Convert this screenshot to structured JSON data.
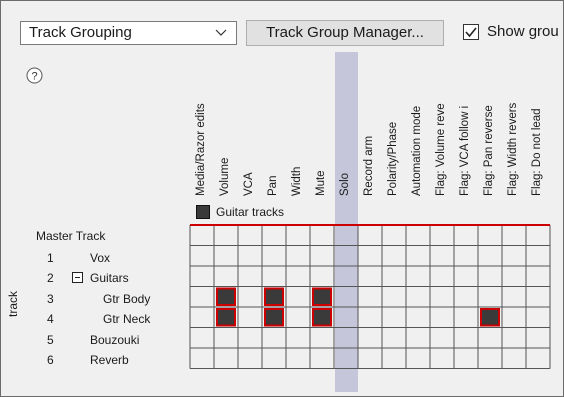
{
  "toolbar": {
    "dropdown_value": "Track Grouping",
    "manager_button": "Track Group Manager...",
    "show_checkbox_label": "Show grou",
    "show_checked": true
  },
  "help_icon": "question-circle-icon",
  "columns": [
    "Media/Razor edits",
    "Volume",
    "VCA",
    "Pan",
    "Width",
    "Mute",
    "Solo",
    "Record arm",
    "Polarity/Phase",
    "Automation mode",
    "Flag: Volume reve",
    "Flag: VCA follow i",
    "Flag: Pan reverse",
    "Flag: Width revers",
    "Flag: Do not lead"
  ],
  "highlighted_column": "Solo",
  "group": {
    "name": "Guitar tracks",
    "color": "#cc0000"
  },
  "track_axis_label": "track",
  "rows": [
    {
      "num": "",
      "name": "Master Track",
      "indent": 0,
      "folder": false
    },
    {
      "num": "1",
      "name": "Vox",
      "indent": 0,
      "folder": false
    },
    {
      "num": "2",
      "name": "Guitars",
      "indent": 0,
      "folder": true
    },
    {
      "num": "3",
      "name": "Gtr Body",
      "indent": 1,
      "folder": false
    },
    {
      "num": "4",
      "name": "Gtr Neck",
      "indent": 1,
      "folder": false
    },
    {
      "num": "5",
      "name": "Bouzouki",
      "indent": 0,
      "folder": false
    },
    {
      "num": "6",
      "name": "Reverb",
      "indent": 0,
      "folder": false
    }
  ],
  "active_cells": [
    {
      "row": "Gtr Body",
      "col": "Volume"
    },
    {
      "row": "Gtr Body",
      "col": "Pan"
    },
    {
      "row": "Gtr Body",
      "col": "Mute"
    },
    {
      "row": "Gtr Neck",
      "col": "Volume"
    },
    {
      "row": "Gtr Neck",
      "col": "Pan"
    },
    {
      "row": "Gtr Neck",
      "col": "Mute"
    },
    {
      "row": "Gtr Neck",
      "col": "Flag: Pan reverse"
    }
  ]
}
